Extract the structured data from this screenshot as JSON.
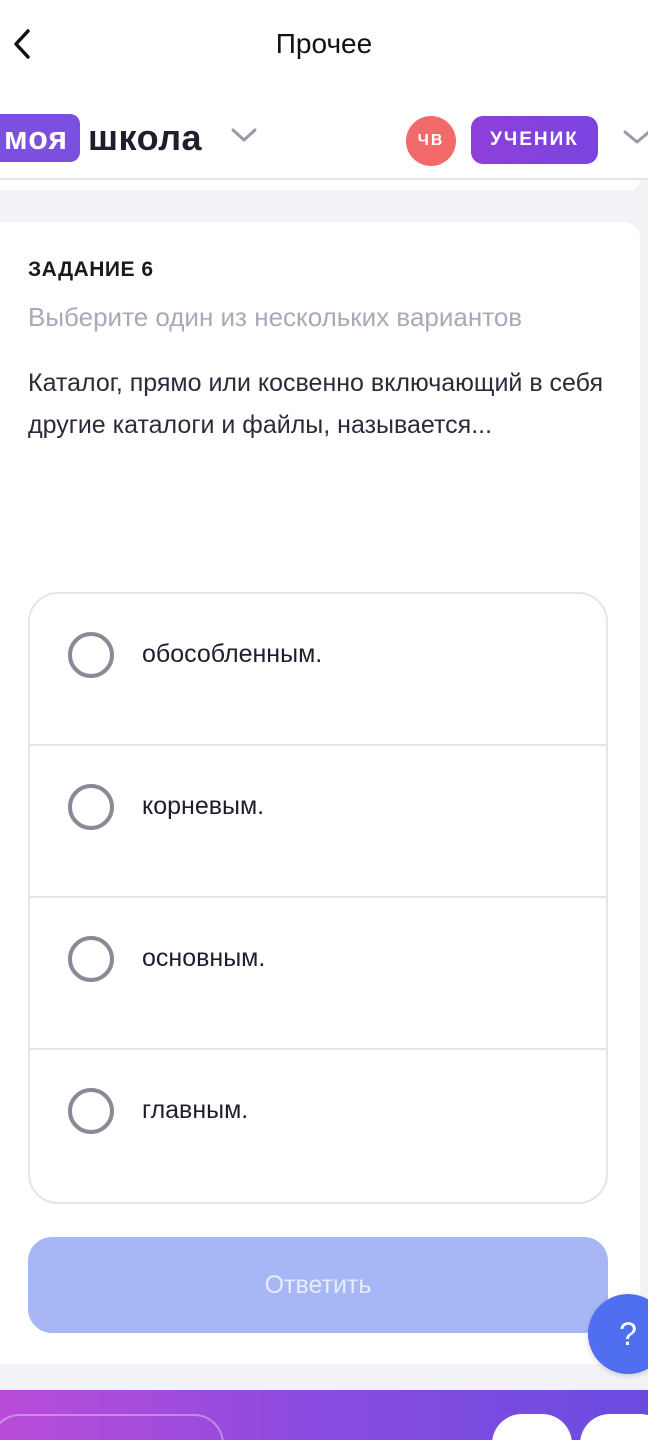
{
  "topbar": {
    "title": "Прочее"
  },
  "header": {
    "logo_box": "моя",
    "logo_word": "школа",
    "avatar_initials": "ЧВ",
    "role": "УЧЕНИК"
  },
  "task": {
    "label": "ЗАДАНИЕ 6",
    "hint": "Выберите один из нескольких вариантов",
    "question": "Каталог, прямо или косвенно включающий в себя другие каталоги и файлы, называется...",
    "options": [
      {
        "label": "обособленным."
      },
      {
        "label": "корневым."
      },
      {
        "label": "основным."
      },
      {
        "label": "главным."
      }
    ],
    "submit_label": "Ответить"
  },
  "help": {
    "label": "?"
  },
  "colors": {
    "accent": "#7b4fe0",
    "avatar": "#f36a6a",
    "submit_disabled": "#a7b7f5",
    "help": "#4f6ff0"
  }
}
